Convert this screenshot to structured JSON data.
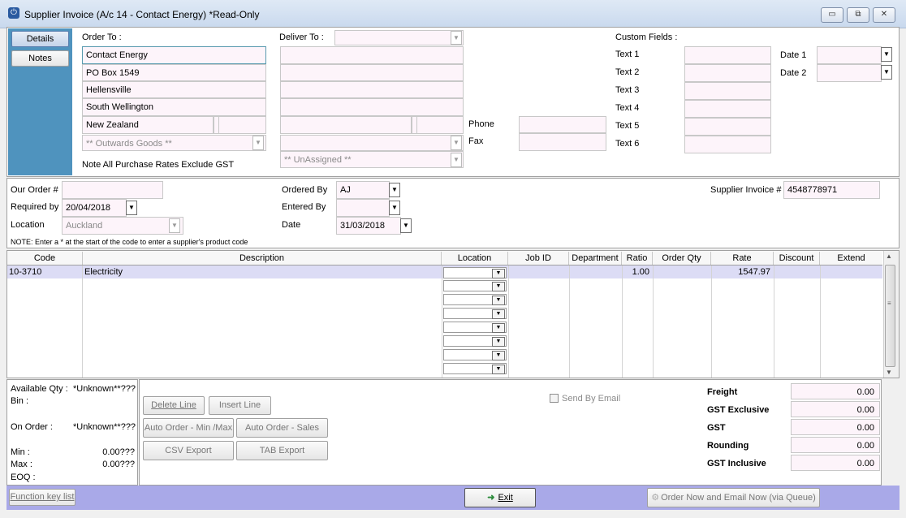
{
  "window": {
    "title": "Supplier Invoice (A/c 14 - Contact Energy) *Read-Only",
    "app_icon": "power-icon",
    "minimize": "▭",
    "restore": "⧉",
    "close": "✕"
  },
  "sidebar": {
    "details_label": "Details",
    "notes_label": "Notes"
  },
  "order_to": {
    "label": "Order To :",
    "lines": [
      "Contact Energy",
      "PO Box 1549",
      "Hellensville",
      "South Wellington",
      "New Zealand"
    ],
    "category": "** Outwards Goods **",
    "note": "Note All Purchase Rates Exclude GST"
  },
  "deliver_to": {
    "label": "Deliver To :",
    "assigned": "** UnAssigned **"
  },
  "contact": {
    "phone_label": "Phone",
    "fax_label": "Fax"
  },
  "custom_fields": {
    "label": "Custom Fields :",
    "texts": [
      "Text 1",
      "Text 2",
      "Text 3",
      "Text 4",
      "Text 5",
      "Text 6"
    ],
    "date1_label": "Date 1",
    "date2_label": "Date 2"
  },
  "order_info": {
    "our_order_label": "Our Order #",
    "required_by_label": "Required by",
    "required_by_value": "20/04/2018",
    "location_label": "Location",
    "location_value": "Auckland",
    "ordered_by_label": "Ordered By",
    "ordered_by_value": "AJ",
    "entered_by_label": "Entered By",
    "date_label": "Date",
    "date_value": "31/03/2018",
    "supplier_invoice_label": "Supplier Invoice #",
    "supplier_invoice_value": "4548778971",
    "note": "NOTE: Enter a * at the start of the code to enter a supplier's product code"
  },
  "grid": {
    "headers": [
      "Code",
      "Description",
      "Location",
      "Job ID",
      "Department",
      "Ratio",
      "Order Qty",
      "Rate",
      "Discount",
      "Extend"
    ],
    "rows": [
      {
        "code": "10-3710",
        "description": "Electricity",
        "ratio": "1.00",
        "rate": "1547.97"
      }
    ]
  },
  "stock": {
    "available_label": "Available Qty :",
    "available_value": "*Unknown**???",
    "bin_label": "Bin :",
    "on_order_label": "On Order :",
    "on_order_value": "*Unknown**???",
    "min_label": "Min :",
    "min_value": "0.00???",
    "max_label": "Max :",
    "max_value": "0.00???",
    "eoq_label": "EOQ :"
  },
  "actions": {
    "delete_line": "Delete Line",
    "insert_line": "Insert Line",
    "auto_min_max": "Auto Order - Min /Max",
    "auto_sales": "Auto Order - Sales",
    "csv_export": "CSV Export",
    "tab_export": "TAB Export",
    "send_by_email": "Send By Email"
  },
  "totals": {
    "freight_label": "Freight",
    "freight": "0.00",
    "gst_excl_label": "GST Exclusive",
    "gst_excl": "0.00",
    "gst_label": "GST",
    "gst": "0.00",
    "rounding_label": "Rounding",
    "rounding": "0.00",
    "gst_incl_label": "GST Inclusive",
    "gst_incl": "0.00"
  },
  "footer": {
    "function_keys": "Function key list",
    "exit": "Exit",
    "order_email": "Order Now and Email Now (via Queue)"
  },
  "colors": {
    "sidebar": "#4f93be",
    "footer": "#a9a9e8",
    "field": "#fdf4fa",
    "selected_row": "#dcdcf5"
  }
}
